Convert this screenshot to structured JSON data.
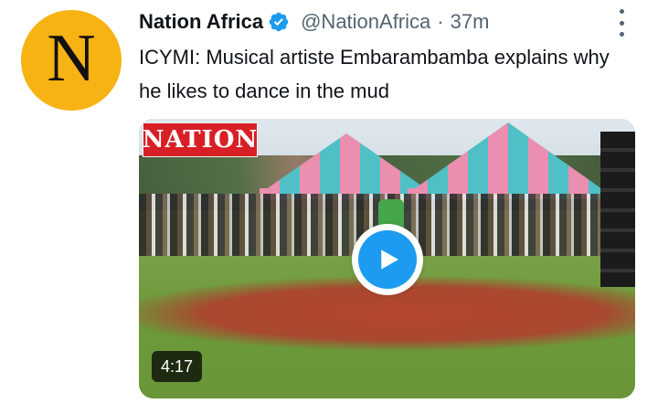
{
  "colors": {
    "accent": "#1d9bf0",
    "text_primary": "#0f1419",
    "text_secondary": "#536471",
    "avatar_bg": "#f7b313",
    "nation_red": "#d81f26"
  },
  "author": {
    "avatar_letter": "N",
    "display_name": "Nation Africa",
    "verified_icon": "verified-badge-icon",
    "handle": "@NationAfrica",
    "separator": "·",
    "time": "37m"
  },
  "menu": {
    "icon": "more-vertical-icon"
  },
  "tweet": {
    "text": "ICYMI: Musical artiste Embarambamba explains why he likes to dance in the mud"
  },
  "media": {
    "overlay_logo": "NATION",
    "play_icon": "play-icon",
    "duration": "4:17"
  }
}
